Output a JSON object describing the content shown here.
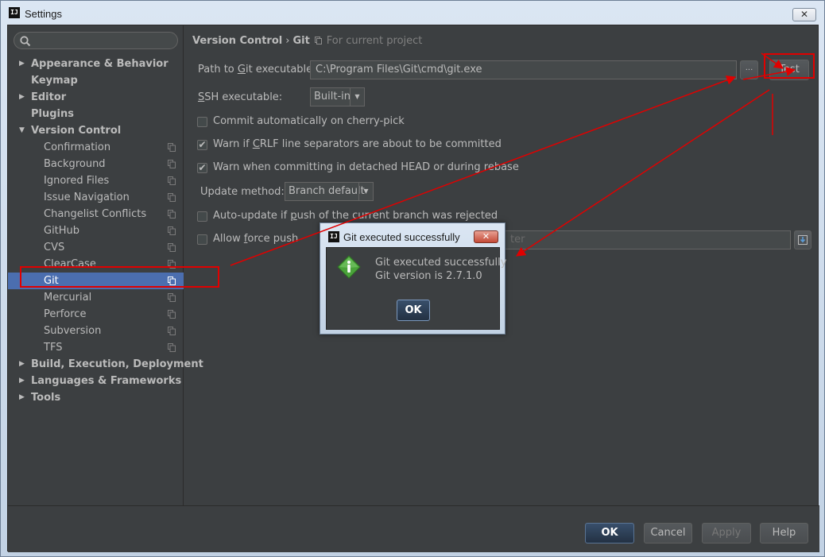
{
  "window": {
    "title": "Settings",
    "icon_text": "IJ",
    "close_symbol": "✕"
  },
  "sidebar": {
    "search_placeholder": "",
    "items": [
      {
        "label": "Appearance & Behavior",
        "level": 0,
        "arrow": "▶"
      },
      {
        "label": "Keymap",
        "level": 0,
        "arrow": ""
      },
      {
        "label": "Editor",
        "level": 0,
        "arrow": "▶"
      },
      {
        "label": "Plugins",
        "level": 0,
        "arrow": ""
      },
      {
        "label": "Version Control",
        "level": 0,
        "arrow": "▼"
      },
      {
        "label": "Confirmation",
        "level": 1
      },
      {
        "label": "Background",
        "level": 1
      },
      {
        "label": "Ignored Files",
        "level": 1
      },
      {
        "label": "Issue Navigation",
        "level": 1
      },
      {
        "label": "Changelist Conflicts",
        "level": 1
      },
      {
        "label": "GitHub",
        "level": 1
      },
      {
        "label": "CVS",
        "level": 1
      },
      {
        "label": "ClearCase",
        "level": 1
      },
      {
        "label": "Git",
        "level": 1,
        "selected": true
      },
      {
        "label": "Mercurial",
        "level": 1
      },
      {
        "label": "Perforce",
        "level": 1
      },
      {
        "label": "Subversion",
        "level": 1
      },
      {
        "label": "TFS",
        "level": 1
      },
      {
        "label": "Build, Execution, Deployment",
        "level": 0,
        "arrow": "▶"
      },
      {
        "label": "Languages & Frameworks",
        "level": 0,
        "arrow": "▶"
      },
      {
        "label": "Tools",
        "level": 0,
        "arrow": "▶"
      }
    ]
  },
  "breadcrumb": {
    "parent": "Version Control",
    "separator": "›",
    "current": "Git",
    "scope": "For current project"
  },
  "form": {
    "path_label_pre": "Path to ",
    "path_label_mnemonic": "G",
    "path_label_post": "it executable:",
    "path_value": "C:\\Program Files\\Git\\cmd\\git.exe",
    "browse_label": "...",
    "test_label": "Test",
    "ssh_label_mnemonic": "S",
    "ssh_label_post": "SH executable:",
    "ssh_value": "Built-in",
    "commit_cherry_pick": {
      "label": "Commit automatically on cherry-pick",
      "checked": false
    },
    "warn_crlf": {
      "label_pre": "Warn if ",
      "label_mnemonic": "C",
      "label_post": "RLF line separators are about to be committed",
      "checked": true
    },
    "warn_detached": {
      "label": "Warn when committing in detached HEAD or during rebase",
      "checked": true
    },
    "update_method_label": "Update method:",
    "update_method_value": "Branch default",
    "auto_update": {
      "label_pre": "Auto-update if ",
      "label_mnemonic": "p",
      "label_post": "ush of the current branch was rejected",
      "checked": false
    },
    "allow_force_push": {
      "label_pre": "Allow ",
      "label_mnemonic": "f",
      "label_post": "orce push",
      "checked": false
    },
    "protected_field_visible_tail": "ter",
    "check_mark": "✔",
    "dropdown_arrow": "▼"
  },
  "buttons": {
    "ok": "OK",
    "cancel": "Cancel",
    "apply": "Apply",
    "help": "Help"
  },
  "dialog": {
    "title": "Git executed successfully",
    "line1": "Git executed successfully",
    "line2": "Git version is 2.7.1.0",
    "ok": "OK",
    "close_symbol": "✕",
    "icon_text": "IJ"
  },
  "colors": {
    "annotation": "#e00000",
    "selection": "#4b6eaf",
    "background": "#3c3f41"
  }
}
